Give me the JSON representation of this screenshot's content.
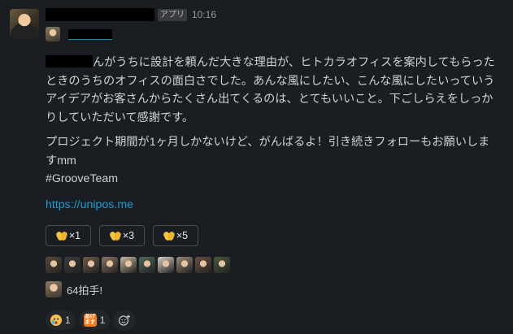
{
  "message": {
    "badge": "アプリ",
    "timestamp": "10:16",
    "paragraph1_rest": "んがうちに設計を頼んだ大きな理由が、ヒトカラオフィスを案内してもらったときのうちのオフィスの面白さでした。あんな風にしたい、こんな風にしたいっていうアイデアがお客さんからたくさん出てくるのは、とてもいいこと。下ごしらえをしっかりしていただいて感謝です。",
    "paragraph2": "プロジェクト期間が1ヶ月しかないけど、がんばるよ！引き続きフォローもお願いしますmm\n#GrooveTeam",
    "link": "https://unipos.me"
  },
  "clap_buttons": [
    {
      "label": "×1",
      "icon": "clap-icon"
    },
    {
      "label": "×3",
      "icon": "clap-icon"
    },
    {
      "label": "×5",
      "icon": "clap-icon"
    }
  ],
  "clappers": [
    {
      "color": "#5a4a3a"
    },
    {
      "color": "#3c3c3c"
    },
    {
      "color": "#6e5a48"
    },
    {
      "color": "#8a7460"
    },
    {
      "color": "#c8b79f"
    },
    {
      "color": "#4d6b5a"
    },
    {
      "color": "#d8d0c4"
    },
    {
      "color": "#9a8a78"
    },
    {
      "color": "#6a5040"
    },
    {
      "color": "#4a5a3a"
    }
  ],
  "clap_summary": "64拍手!",
  "reactions": [
    {
      "icon": "crying-face-icon",
      "count": "1"
    },
    {
      "icon": "agemasu-stamp-icon",
      "stamp_text": "あげます",
      "count": "1"
    }
  ]
}
